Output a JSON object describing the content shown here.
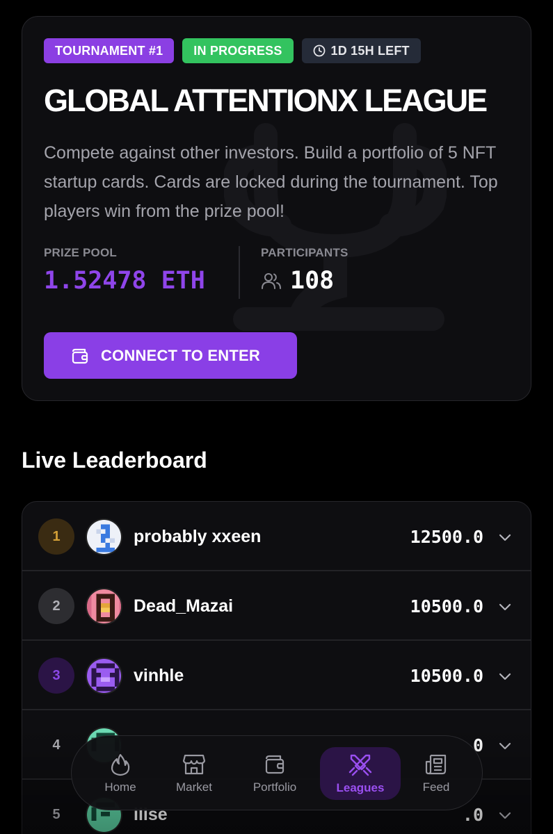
{
  "tournament": {
    "badge_number": "TOURNAMENT #1",
    "badge_status": "IN PROGRESS",
    "badge_time": "1D 15H LEFT",
    "title": "GLOBAL ATTENTIONX LEAGUE",
    "description": "Compete against other investors. Build a portfolio of 5 NFT startup cards. Cards are locked during the tournament. Top players win from the prize pool!",
    "prize_label": "PRIZE POOL",
    "prize_value": "1.52478 ETH",
    "participants_label": "PARTICIPANTS",
    "participants_value": "108",
    "connect_label": "CONNECT TO ENTER"
  },
  "leaderboard": {
    "title": "Live Leaderboard",
    "rows": [
      {
        "rank": "1",
        "name": "probably xxeen",
        "score": "12500.0"
      },
      {
        "rank": "2",
        "name": "Dead_Mazai",
        "score": "10500.0"
      },
      {
        "rank": "3",
        "name": "vinhle",
        "score": "10500.0"
      },
      {
        "rank": "4",
        "name": "",
        "score": "0"
      },
      {
        "rank": "5",
        "name": "ilise",
        "score": ".0"
      }
    ]
  },
  "nav": {
    "home": "Home",
    "market": "Market",
    "portfolio": "Portfolio",
    "leagues": "Leagues",
    "feed": "Feed"
  },
  "colors": {
    "accent": "#8a3fe6",
    "success": "#33c35f",
    "gold": "#d4a037"
  }
}
